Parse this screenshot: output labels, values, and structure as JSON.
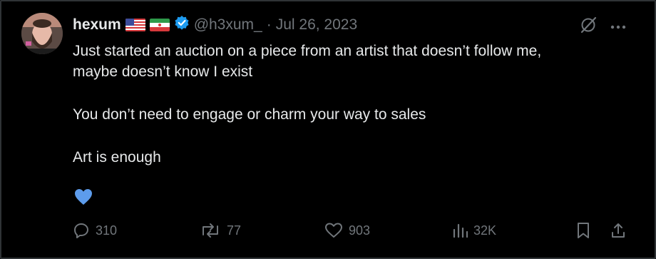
{
  "tweet": {
    "display_name": "hexum",
    "handle": "@h3xum_",
    "separator": "·",
    "date": "Jul 26, 2023",
    "flags": [
      "us-flag",
      "iran-flag"
    ],
    "verified_icon": "verified-badge-icon",
    "lines": [
      "Just started an auction on a piece from an artist that doesn’t follow me,",
      "maybe doesn’t know I exist",
      "You don’t need to engage or charm your way to sales",
      "Art is enough"
    ],
    "emoji": "blue-heart-emoji"
  },
  "actions": {
    "replies": "310",
    "reposts": "77",
    "likes": "903",
    "views": "32K"
  },
  "colors": {
    "background": "#000000",
    "text": "#e7e9ea",
    "muted": "#71767b",
    "verified": "#1d9bf0",
    "heart": "#5d9cec"
  }
}
